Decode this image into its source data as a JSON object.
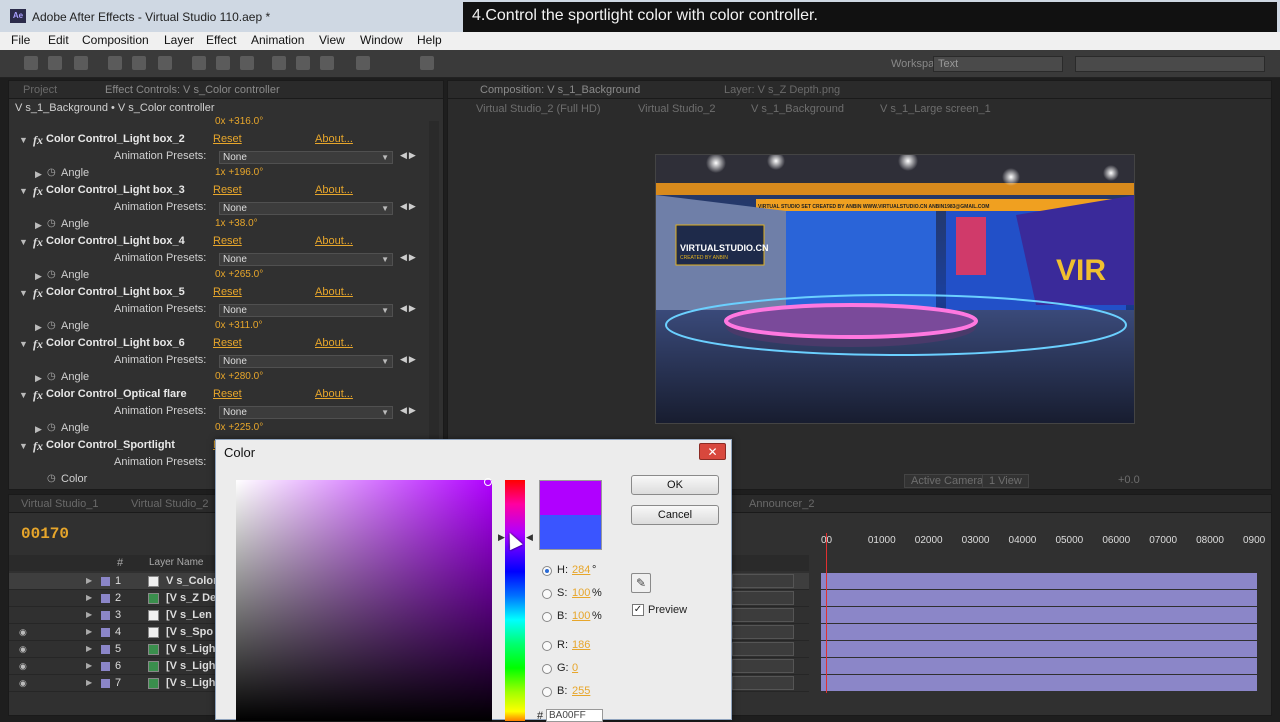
{
  "window": {
    "title": "Adobe After Effects - Virtual Studio 110.aep *",
    "icon_text": "Ae"
  },
  "menu": [
    "File",
    "Edit",
    "Composition",
    "Layer",
    "Effect",
    "Animation",
    "View",
    "Window",
    "Help"
  ],
  "tooltip": "4.Control the sportlight color with color controller.",
  "toolbar": {
    "workspace_label": "Workspace:",
    "workspace_value": "Text"
  },
  "left_panel": {
    "tabs": [
      "Project",
      "Effect Controls: V s_Color controller"
    ],
    "header": "V s_1_Background • V s_Color controller",
    "top_value": "0x +316.0°",
    "effects": [
      {
        "name": "Color Control_Light box_2",
        "angle": "1x +196.0°"
      },
      {
        "name": "Color Control_Light box_3",
        "angle": "1x +38.0°"
      },
      {
        "name": "Color Control_Light box_4",
        "angle": "0x +265.0°"
      },
      {
        "name": "Color Control_Light box_5",
        "angle": "0x +311.0°"
      },
      {
        "name": "Color Control_Light box_6",
        "angle": "0x +280.0°"
      },
      {
        "name": "Color Control_Optical flare",
        "angle": "0x +225.0°"
      }
    ],
    "last_effect": "Color Control_Sportlight",
    "color_label": "Color",
    "reset": "Reset",
    "about": "About...",
    "presets_label": "Animation Presets:",
    "presets_value": "None",
    "angle_label": "Angle"
  },
  "comp_panel": {
    "tabs": [
      "Composition: V s_1_Background",
      "Layer: V s_Z Depth.png"
    ],
    "breadcrumb": [
      "Virtual Studio_2 (Full HD)",
      "Virtual Studio_2",
      "V s_1_Background",
      "V s_1_Large screen_1"
    ],
    "footer": {
      "camera": "Active Camera",
      "views": "1 View",
      "exposure": "+0.0"
    },
    "viewer": {
      "sign_1": "VIRTUALSTUDIO.CN",
      "sign_1_sub": "CREATED BY ANBIN",
      "banner": "VIRTUAL STUDIO SET   CREATED BY ANBIN   WWW.VIRTUALSTUDIO.CN   ANBIN1983@GMAIL.COM",
      "big_text": "VIR"
    }
  },
  "timeline": {
    "tabs": [
      "Virtual Studio_1",
      "Virtual Studio_2",
      "Announcer_2"
    ],
    "timecode": "00170",
    "col_hash": "#",
    "col_layer": "Layer Name",
    "ticks": [
      "00",
      "01000",
      "02000",
      "03000",
      "04000",
      "05000",
      "06000",
      "07000",
      "08000",
      "0900"
    ],
    "layers": [
      {
        "idx": "1",
        "name": "V s_Color",
        "type": "solid",
        "eye": false,
        "sel": true
      },
      {
        "idx": "2",
        "name": "[V s_Z De",
        "type": "img",
        "eye": false,
        "sel": false
      },
      {
        "idx": "3",
        "name": "[V s_Len",
        "type": "solid",
        "eye": false,
        "sel": false
      },
      {
        "idx": "4",
        "name": "[V s_Spo",
        "type": "solid",
        "eye": true,
        "sel": false
      },
      {
        "idx": "5",
        "name": "[V s_Ligh",
        "type": "img",
        "eye": true,
        "sel": false
      },
      {
        "idx": "6",
        "name": "[V s_Ligh",
        "type": "img",
        "eye": true,
        "sel": false
      },
      {
        "idx": "7",
        "name": "[V s_Ligh",
        "type": "img",
        "eye": true,
        "sel": false
      }
    ]
  },
  "color_dialog": {
    "title": "Color",
    "close": "✕",
    "ok": "OK",
    "cancel": "Cancel",
    "preview": "Preview",
    "preview_checked": true,
    "fields": [
      {
        "label": "H:",
        "value": "284",
        "unit": "°",
        "selected": true
      },
      {
        "label": "S:",
        "value": "100",
        "unit": "%",
        "selected": false
      },
      {
        "label": "B:",
        "value": "100",
        "unit": "%",
        "selected": false
      },
      {
        "label": "R:",
        "value": "186",
        "unit": "",
        "selected": false
      },
      {
        "label": "G:",
        "value": "0",
        "unit": "",
        "selected": false
      },
      {
        "label": "B:",
        "value": "255",
        "unit": "",
        "selected": false
      }
    ],
    "hex_label": "#",
    "hex": "BA00FF",
    "new_color": "#b000ff",
    "old_color": "#3a55ff"
  }
}
